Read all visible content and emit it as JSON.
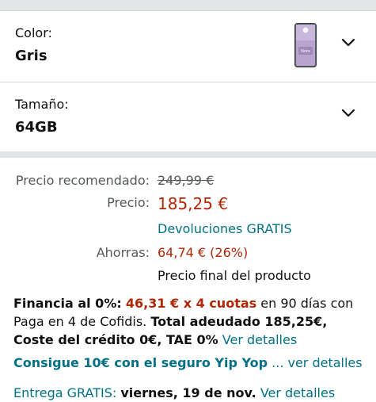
{
  "color_option": {
    "label": "Color:",
    "value": "Gris",
    "thumb_text": "Redmi Note 10S"
  },
  "size_option": {
    "label": "Tamaño:",
    "value": "64GB"
  },
  "pricing": {
    "recommended_label": "Precio recomendado:",
    "recommended_value": "249,99 €",
    "price_label": "Precio:",
    "price_value": "185,25 €",
    "returns_text": "Devoluciones GRATIS",
    "savings_label": "Ahorras:",
    "savings_value": "64,74 € (26%)",
    "final_price_note": "Precio final del producto"
  },
  "financing": {
    "intro": "Financia al 0%:",
    "installments": "46,31 € x 4 cuotas",
    "term": " en 90 días con Paga en 4 de Cofidis. ",
    "total": "Total adeudado 185,25€, Coste del crédito 0€, TAE 0%",
    "details_link": "Ver detalles"
  },
  "insurance": {
    "promo": "Consigue 10€ con el seguro Yip Yop",
    "more_link": "... ver detalles"
  },
  "delivery": {
    "prefix": "Entrega GRATIS: ",
    "date": "viernes, 19 de nov.",
    "details_link": "Ver detalles"
  },
  "colors": {
    "link": "#007185",
    "price_red": "#b12704",
    "text": "#0f1111",
    "muted": "#565959",
    "divider_band": "#e3e6e6"
  }
}
